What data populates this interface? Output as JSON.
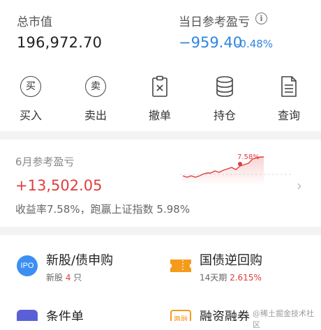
{
  "summary": {
    "total_value_label": "总市值",
    "total_value": "196,972.70",
    "daily_pl_label": "当日参考盈亏",
    "daily_pl_value": "−959.40",
    "daily_pl_pct": "-0.48%",
    "info_glyph": "i"
  },
  "actions": [
    {
      "label": "买入",
      "glyph": "买",
      "icon": "buy-icon"
    },
    {
      "label": "卖出",
      "glyph": "卖",
      "icon": "sell-icon"
    },
    {
      "label": "撤单",
      "icon": "cancel-order-icon"
    },
    {
      "label": "持仓",
      "icon": "positions-icon"
    },
    {
      "label": "查询",
      "icon": "query-icon"
    }
  ],
  "monthly": {
    "title": "6月参考盈亏",
    "value": "+13,502.05",
    "subtitle": "收益率7.58%，跑赢上证指数 5.98%",
    "peak_label": "7.58%"
  },
  "services": [
    {
      "title": "新股/债申购",
      "sub_prefix": "新股 ",
      "sub_highlight": "4",
      "sub_suffix": " 只",
      "icon": "ipo-icon",
      "icon_text": "IPO"
    },
    {
      "title": "国债逆回购",
      "sub_prefix": "14天期 ",
      "sub_highlight": "2.615%",
      "sub_suffix": "",
      "icon": "ticket-icon"
    },
    {
      "title": "条件单",
      "icon": "condition-order-icon"
    },
    {
      "title": "融资融券",
      "icon": "margin-trading-icon",
      "icon_text": "两融"
    }
  ],
  "watermark": "@稀土掘金技术社区",
  "colors": {
    "up": "#e03c3c",
    "down": "#2f86e0",
    "ipo_blue": "#3b8ff3",
    "ticket_orange": "#f59a1b"
  }
}
